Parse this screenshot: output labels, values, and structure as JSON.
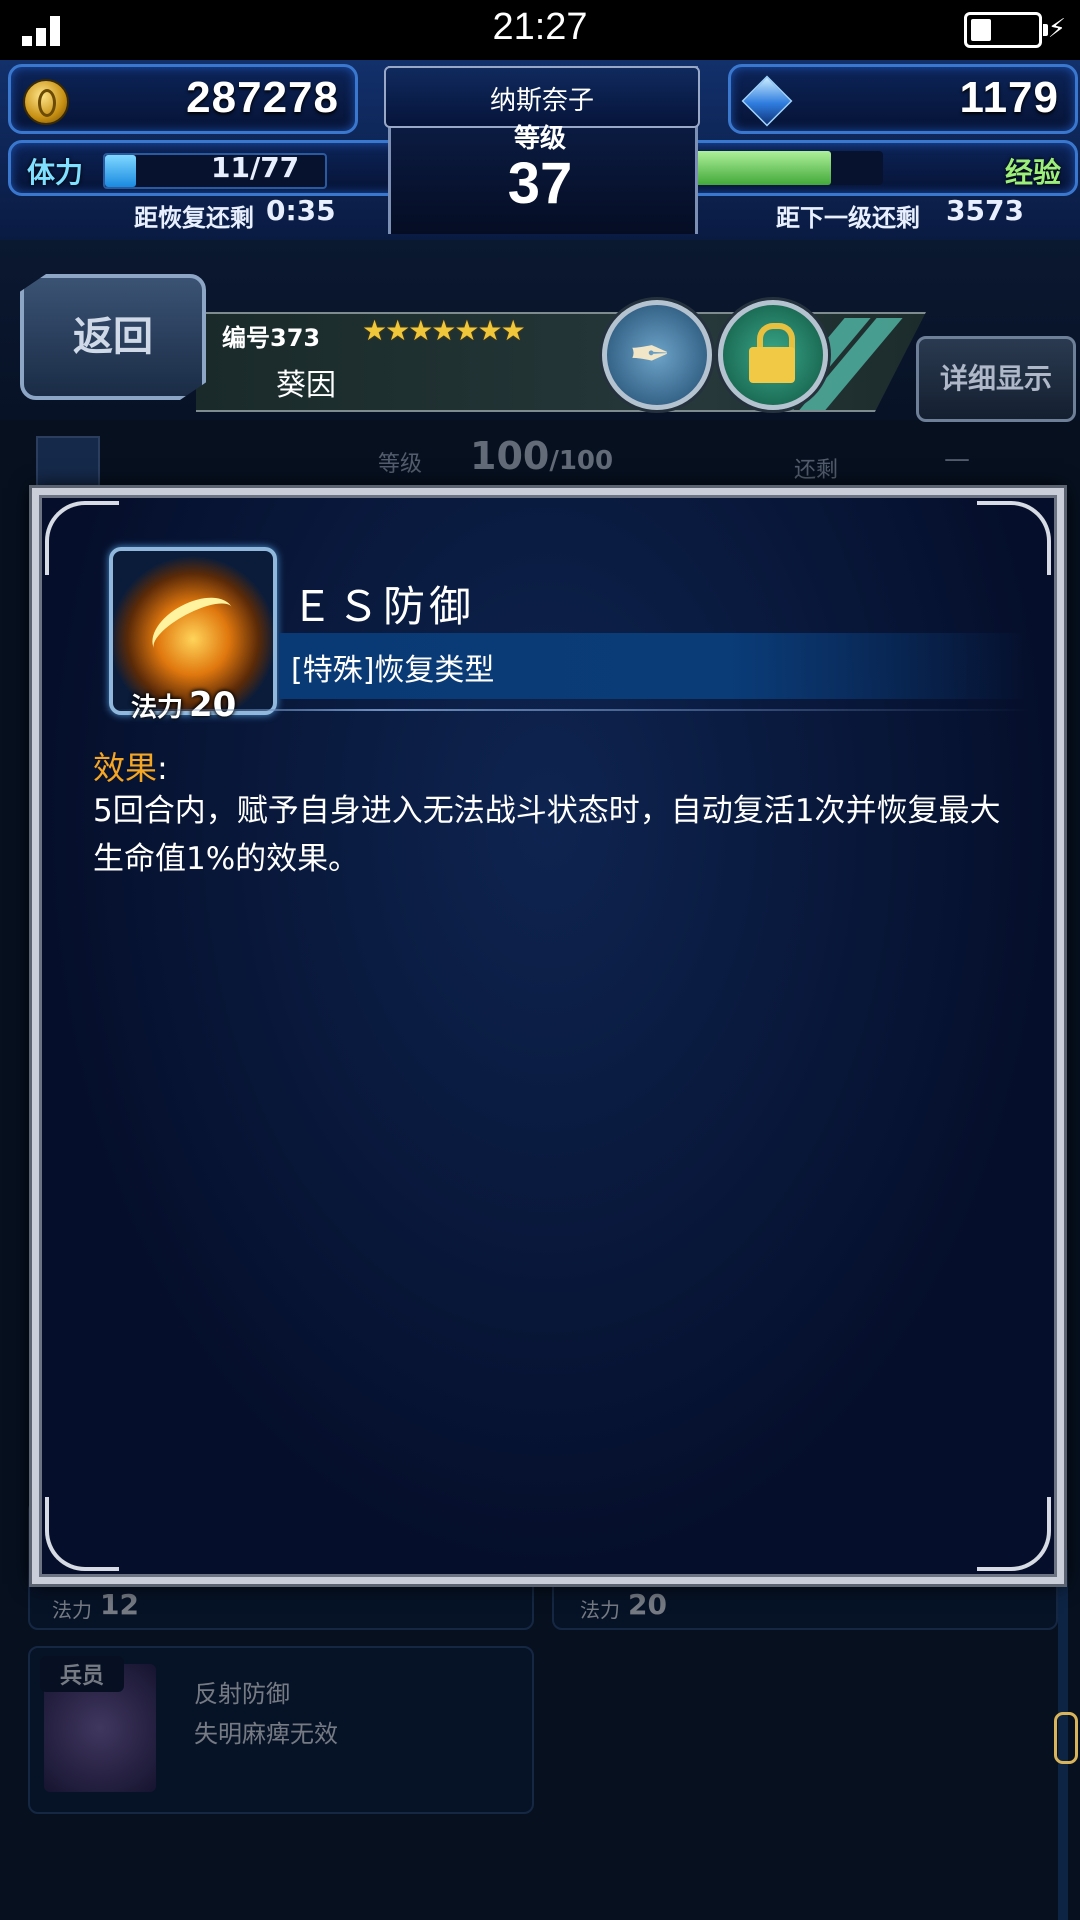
{
  "status_bar": {
    "time": "21:27"
  },
  "hud": {
    "gil": "287278",
    "gems": "1179",
    "player_name": "纳斯奈子",
    "level_label": "等级",
    "level": "37",
    "stamina_label": "体力",
    "stamina": "11/77",
    "stamina_fill": 0.14,
    "recover_label": "距恢复还剩",
    "recover_time": "0:35",
    "exp_label": "经验",
    "exp_fill": 0.78,
    "next_level_label": "距下一级还剩",
    "next_level_value": "3573"
  },
  "header": {
    "back": "返回",
    "unit_no": "编号373",
    "stars": "★★★★★★★",
    "unit_name": "葵因",
    "detail": "详细显示"
  },
  "background": {
    "level_label": "等级",
    "level_value": "100",
    "level_max": "/100",
    "remain_label": "还剩",
    "remain_value": "—",
    "card1_cost_label": "法力",
    "card1_cost": "12",
    "card2_cost_label": "法力",
    "card2_cost": "20",
    "card3_tag": "兵员",
    "card3_title": "反射防御",
    "card3_desc": "失明麻痺无效"
  },
  "modal": {
    "cost_label": "法力",
    "cost": "20",
    "ability_name": "ＥＳ防御",
    "ability_type": "[特殊]恢复类型",
    "effect_label": "效果",
    "effect_colon": ":",
    "effect_text": "5回合内，赋予自身进入无法战斗状态时，自动复活1次并恢复最大生命值1%的效果。"
  }
}
